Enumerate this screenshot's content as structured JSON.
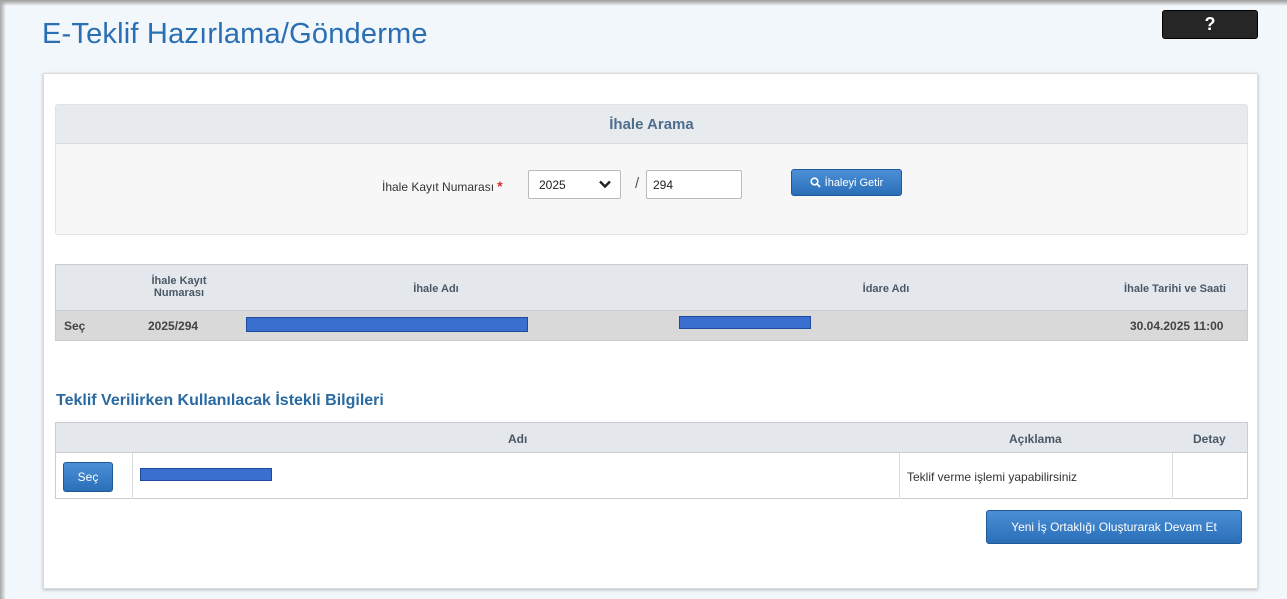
{
  "page": {
    "title": "E-Teklif Hazırlama/Gönderme",
    "help_label": "?"
  },
  "search": {
    "header": "İhale Arama",
    "field_label": "İhale Kayıt Numarası",
    "required_mark": "*",
    "year_value": "2025",
    "slash": "/",
    "number_value": "294",
    "fetch_button_label": "İhaleyi Getir"
  },
  "tender_table": {
    "columns": {
      "number_line1": "İhale Kayıt",
      "number_line2": "Numarası",
      "name": "İhale Adı",
      "admin": "İdare Adı",
      "date": "İhale Tarihi ve Saati"
    },
    "rows": [
      {
        "select": "Seç",
        "number": "2025/294",
        "date": "30.04.2025 11:00"
      }
    ]
  },
  "bidder_section": {
    "title": "Teklif Verilirken Kullanılacak İstekli Bilgileri",
    "columns": {
      "name": "Adı",
      "description": "Açıklama",
      "detail": "Detay"
    },
    "rows": [
      {
        "select_label": "Seç",
        "description": "Teklif verme işlemi yapabilirsiniz"
      }
    ],
    "continue_button_label": "Yeni İş Ortaklığı Oluşturarak Devam Et"
  },
  "colors": {
    "title_blue": "#2a6fb4",
    "button_blue": "#2a6fb8",
    "redaction_blue": "#3a6fd0",
    "required_red": "#d9302c"
  }
}
